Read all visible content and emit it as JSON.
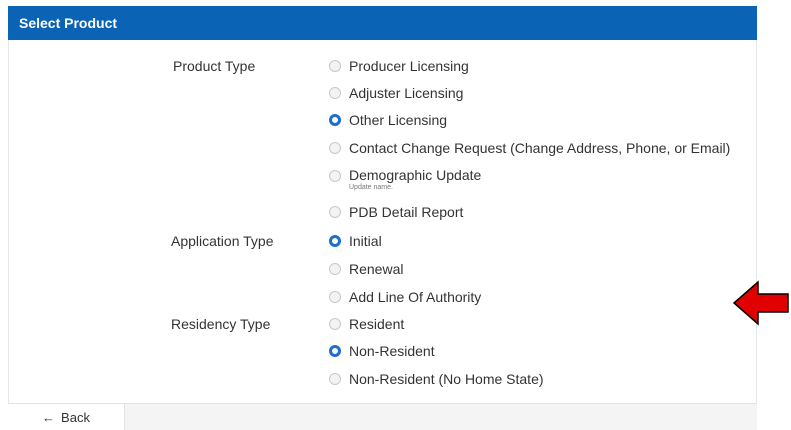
{
  "header": {
    "title": "Select Product"
  },
  "product_type": {
    "label": "Product Type",
    "options": [
      {
        "label": "Producer Licensing",
        "checked": false
      },
      {
        "label": "Adjuster Licensing",
        "checked": false
      },
      {
        "label": "Other Licensing",
        "checked": true
      },
      {
        "label": "Contact Change Request (Change Address, Phone, or Email)",
        "checked": false
      },
      {
        "label": "Demographic Update",
        "sublabel": "Update name.",
        "checked": false
      },
      {
        "label": "PDB Detail Report",
        "checked": false
      }
    ]
  },
  "application_type": {
    "label": "Application Type",
    "options": [
      {
        "label": "Initial",
        "checked": true
      },
      {
        "label": "Renewal",
        "checked": false
      },
      {
        "label": "Add Line Of Authority",
        "checked": false
      }
    ]
  },
  "residency_type": {
    "label": "Residency Type",
    "options": [
      {
        "label": "Resident",
        "checked": false
      },
      {
        "label": "Non-Resident",
        "checked": true
      },
      {
        "label": "Non-Resident (No Home State)",
        "checked": false
      }
    ]
  },
  "footer": {
    "back_label": "Back"
  },
  "colors": {
    "header": "#0b63b6",
    "radio_checked": "#1a6fd1",
    "arrow": "#e00000"
  }
}
